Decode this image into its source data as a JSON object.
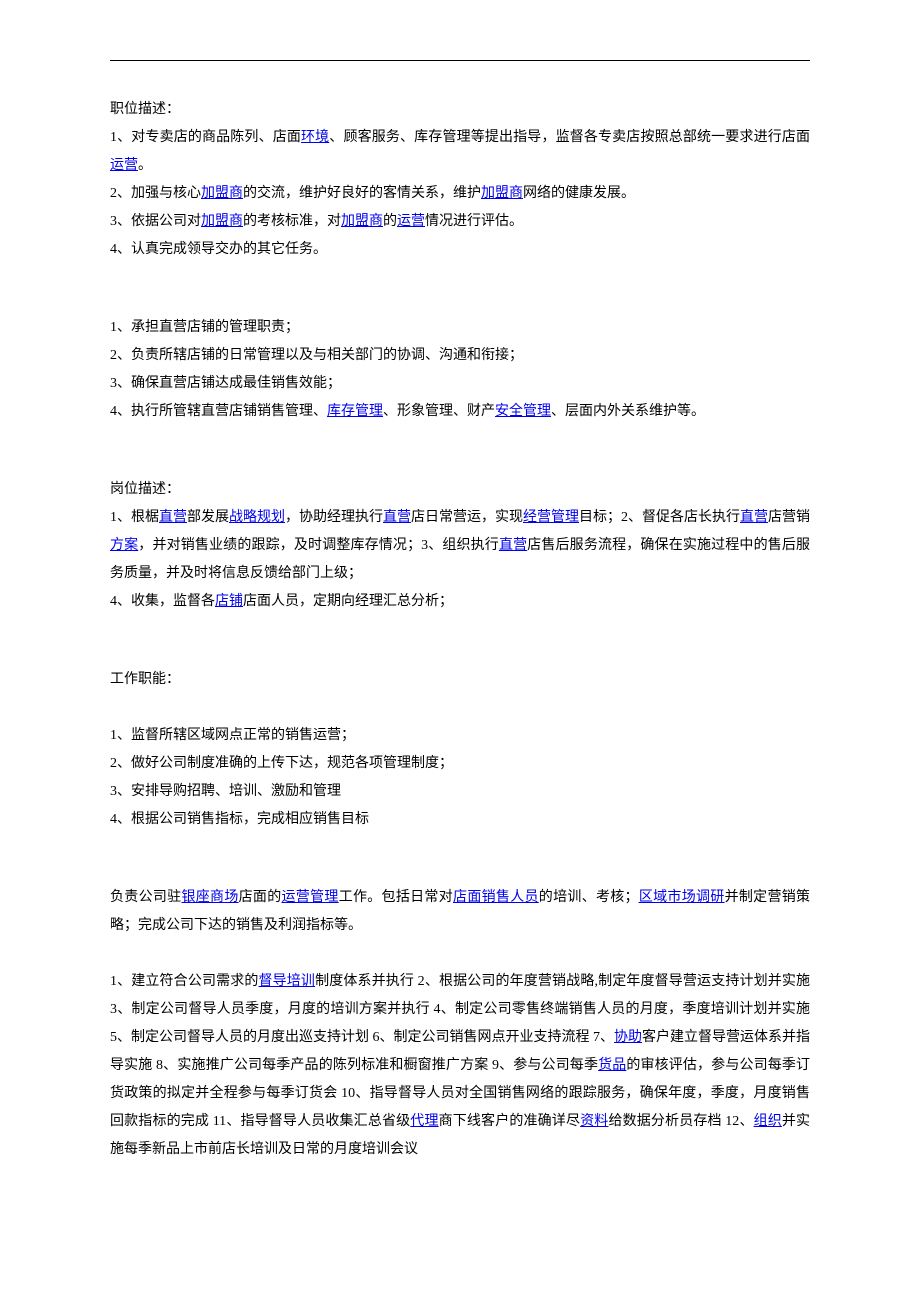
{
  "section1": {
    "heading": "职位描述：",
    "line1a": "1、对专卖店的商品陈列、店面",
    "link1a": "环境",
    "line1b": "、顾客服务、库存管理等提出指导，监督各专卖店按照总部统一要求进行店面",
    "link1b": "运营",
    "line1c": "。",
    "line2a": "2、加强与核心",
    "link2a": "加盟商",
    "line2b": "的交流，维护好良好的客情关系，维护",
    "link2b": "加盟商",
    "line2c": "网络的健康发展。",
    "line3a": "3、依据公司对",
    "link3a": "加盟商",
    "line3b": "的考核标准，对",
    "link3b": "加盟商",
    "line3c": "的",
    "link3c": "运营",
    "line3d": "情况进行评估。",
    "line4": "4、认真完成领导交办的其它任务。"
  },
  "section2": {
    "line1": "1、承担直营店铺的管理职责；",
    "line2": "2、负责所辖店铺的日常管理以及与相关部门的协调、沟通和衔接；",
    "line3": "3、确保直营店铺达成最佳销售效能；",
    "line4a": "4、执行所管辖直营店铺销售管理、",
    "link4a": "库存管理",
    "line4b": "、形象管理、财产",
    "link4b": "安全管理",
    "line4c": "、层面内外关系维护等。"
  },
  "section3": {
    "heading": "岗位描述：",
    "line1a": "1、根椐",
    "link1a": "直营",
    "line1b": "部发展",
    "link1b": "战略规划",
    "line1c": "，协助经理执行",
    "link1c": "直营",
    "line1d": "店日常营运，实现",
    "link1d": "经营管理",
    "line1e": "目标；2、督促各店长执行",
    "link1e": "直营",
    "line1f": "店营销",
    "link1f": "方案",
    "line1g": "，并对销售业绩的跟踪，及时调整库存情况；3、组织执行",
    "link1g": "直营",
    "line1h": "店售后服务流程，确保在实施过程中的售后服务质量，并及时将信息反馈给部门上级；",
    "line4a": "4、收集，监督各",
    "link4a": "店铺",
    "line4b": "店面人员，定期向经理汇总分析；"
  },
  "section4": {
    "heading": "工作职能：",
    "line1": "1、监督所辖区域网点正常的销售运营；",
    "line2": "2、做好公司制度准确的上传下达，规范各项管理制度；",
    "line3": "3、安排导购招聘、培训、激励和管理",
    "line4": "4、根据公司销售指标，完成相应销售目标"
  },
  "section5": {
    "line1a": "负责公司驻",
    "link1a": "银座商场",
    "line1b": "店面的",
    "link1b": "运营管理",
    "line1c": "工作。包括日常对",
    "link1c": "店面销售人员",
    "line1d": "的培训、考核；",
    "link1d": "区域市场调研",
    "line1e": "并制定营销策略；完成公司下达的销售及利润指标等。"
  },
  "section6": {
    "t1": "1、建立符合公司需求的",
    "link1": "督导培训",
    "t2": "制度体系并执行 2、根据公司的年度营销战略,制定年度督导营运支持计划并实施 3、制定公司督导人员季度，月度的培训方案并执行 4、制定公司零售终端销售人员的月度，季度培训计划并实施 5、制定公司督导人员的月度出巡支持计划 6、制定公司销售网点开业支持流程 7、",
    "link2": "协助",
    "t3": "客户建立督导营运体系并指导实施 8、实施推广公司每季产品的陈列标准和橱窗推广方案 9、参与公司每季",
    "link3": "货品",
    "t4": "的审核评估，参与公司每季订货政策的拟定并全程参与每季订货会 10、指导督导人员对全国销售网络的跟踪服务，确保年度，季度，月度销售回款指标的完成 11、指导督导人员收集汇总省级",
    "link4": "代理",
    "t5": "商下线客户的准确详尽",
    "link5": "资料",
    "t6": "给数据分析员存档 12、",
    "link6": "组织",
    "t7": "并实施每季新品上市前店长培训及日常的月度培训会议"
  }
}
